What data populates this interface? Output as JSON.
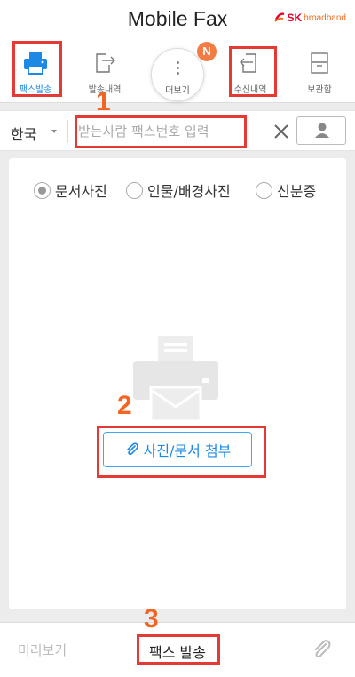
{
  "header": {
    "title": "Mobile Fax",
    "brand_sk": "SK",
    "brand_name": "broadband"
  },
  "tabs": [
    {
      "label": "팩스발송",
      "icon": "printer-icon",
      "active": true
    },
    {
      "label": "발송내역",
      "icon": "outbox-icon",
      "active": false
    },
    {
      "label": "수신내역",
      "icon": "inbox-icon",
      "active": false
    },
    {
      "label": "보관함",
      "icon": "archive-icon",
      "active": false
    }
  ],
  "more": {
    "label": "더보기",
    "badge": "N"
  },
  "steps": {
    "one": "1",
    "two": "2",
    "three": "3"
  },
  "recipient": {
    "country": "한국",
    "placeholder": "받는사람 팩스번호 입력",
    "value": ""
  },
  "doc_types": {
    "selected": "문서사진",
    "options": [
      "문서사진",
      "인물/배경사진",
      "신분증"
    ]
  },
  "attach": {
    "label": "사진/문서 첨부"
  },
  "bottom": {
    "preview_label": "미리보기",
    "send_label": "팩스 발송"
  },
  "colors": {
    "accent": "#1e88e5",
    "highlight": "#e53935",
    "step_number": "#f26522",
    "badge": "#f27b46"
  }
}
